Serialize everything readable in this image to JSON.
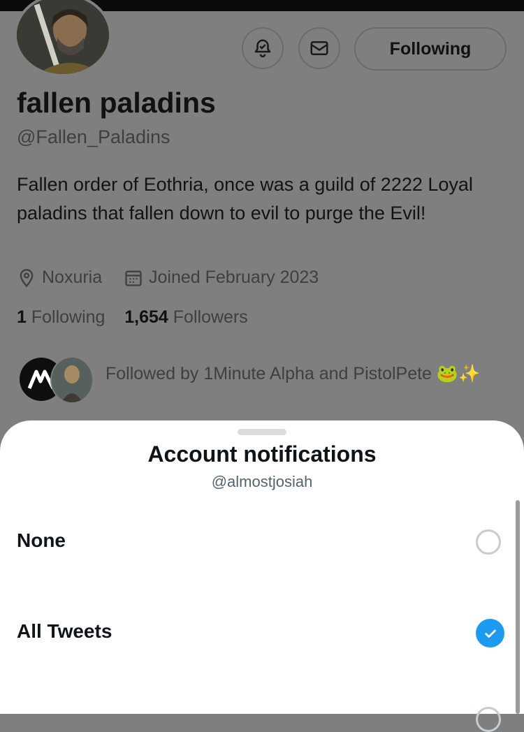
{
  "profile": {
    "name": "fallen paladins",
    "handle": "@Fallen_Paladins",
    "bio": "Fallen order of Eothria, once was a guild of 2222 Loyal paladins that fallen down to evil to purge the Evil!",
    "location": "Noxuria",
    "joined": "Joined February 2023",
    "following_count": "1",
    "following_label": "Following",
    "followers_count": "1,654",
    "followers_label": "Followers",
    "followed_by": "Followed by 1Minute Alpha and PistolPete 🐸✨"
  },
  "actions": {
    "follow_label": "Following"
  },
  "sheet": {
    "title": "Account notifications",
    "subtitle": "@almostjosiah",
    "options": [
      {
        "label": "None",
        "selected": false
      },
      {
        "label": "All Tweets",
        "selected": true
      }
    ]
  },
  "colors": {
    "accent": "#1d9bf0",
    "overlay": "#7f7f7f"
  }
}
